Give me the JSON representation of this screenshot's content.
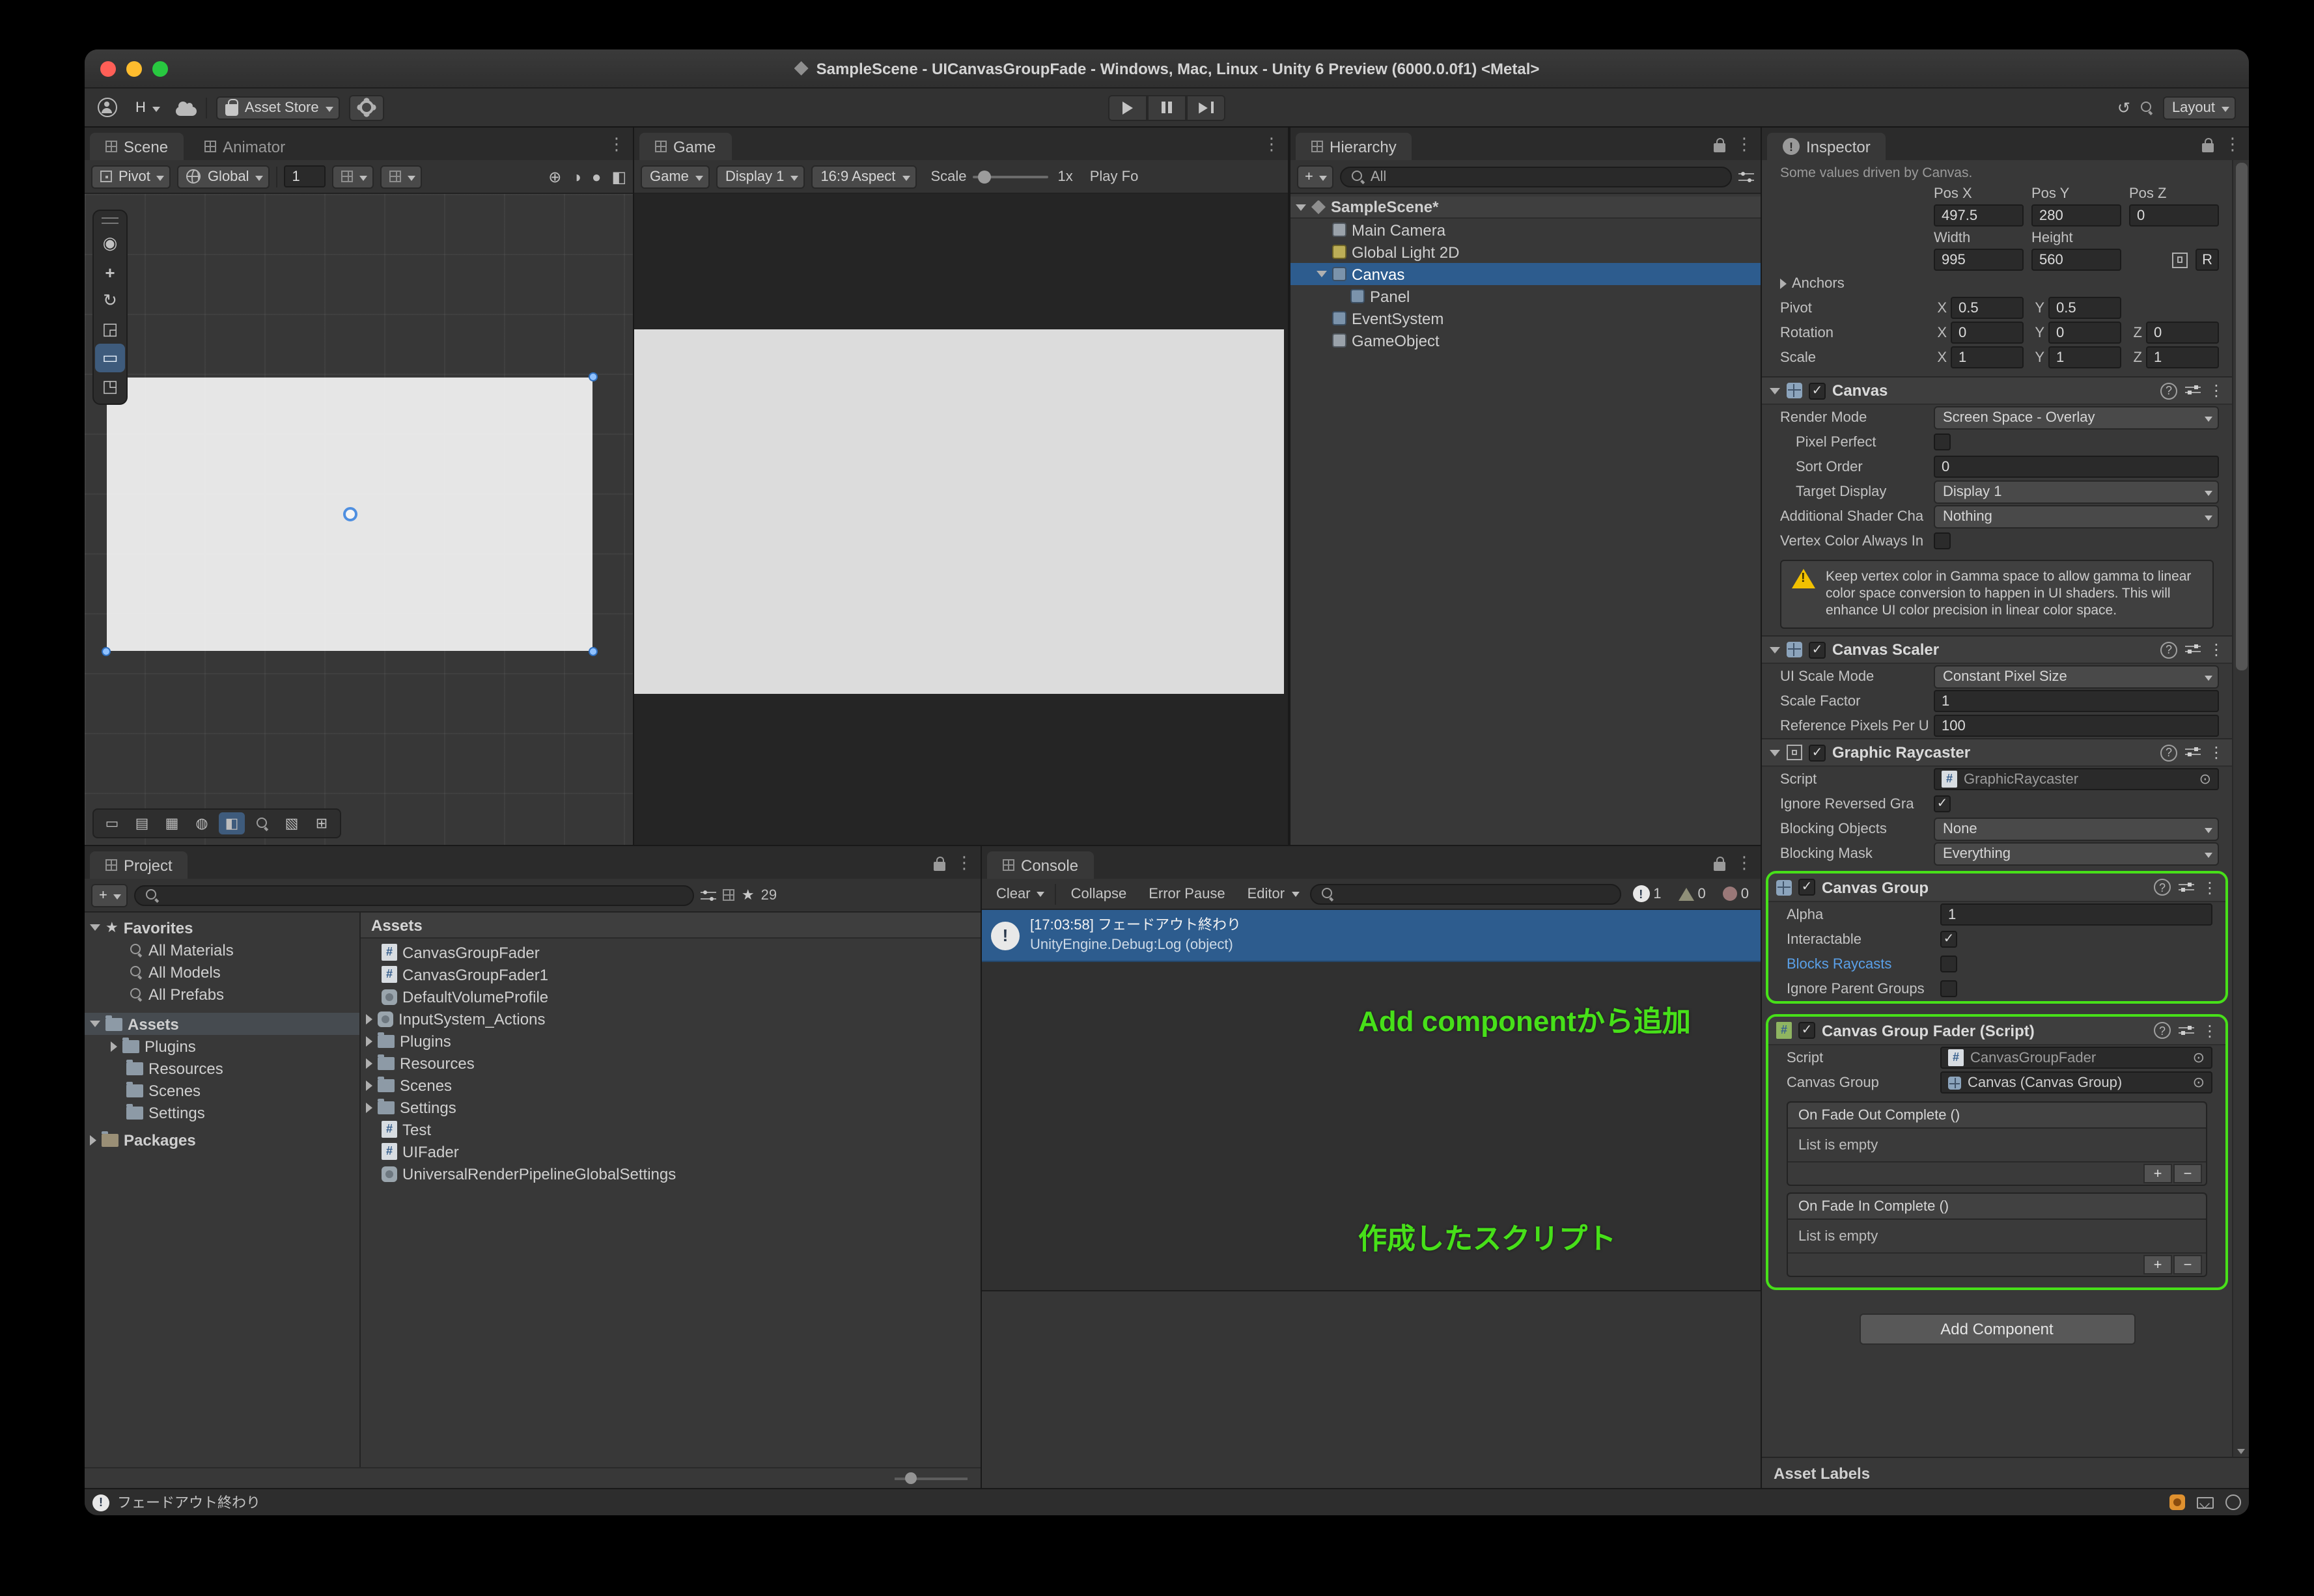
{
  "colors": {
    "accent_green": "#47e019",
    "selection_blue": "#2d5c8e",
    "link_blue": "#5aa0e8",
    "warning_yellow": "#f2c100"
  },
  "titlebar": {
    "title": "SampleScene - UICanvasGroupFade - Windows, Mac, Linux - Unity 6 Preview (6000.0.0f1) <Metal>"
  },
  "toolbar": {
    "account_label": "H",
    "asset_store_label": "Asset Store",
    "layout_label": "Layout"
  },
  "icons": {
    "check": "✓",
    "menu": "⋮",
    "plus": "+",
    "minus": "−",
    "star": "★",
    "history": "↺",
    "picker": "⊙",
    "help": "?",
    "view_tool": "◉",
    "move_tool": "+",
    "rotate_tool": "↻",
    "scale_tool": "◲",
    "rect_tool": "▭",
    "transform_tool": "◳",
    "scene_cam_1": "⊕",
    "scene_cam_2": "◑",
    "scene_cam_3": "●",
    "scene_cam_4": "◧",
    "scene_bottom": [
      "▭",
      "▤",
      "▦",
      "◍",
      "◧",
      "▧",
      "▣",
      "⊞"
    ]
  },
  "scene": {
    "tab": "Scene",
    "tab_animator": "Animator",
    "pivot": "Pivot",
    "global": "Global",
    "grid_size": "1"
  },
  "game": {
    "tab": "Game",
    "menu": "Game",
    "display": "Display 1",
    "aspect": "16:9 Aspect",
    "scale_label": "Scale",
    "scale_value": "1x",
    "play_focused": "Play Fo"
  },
  "hierarchy": {
    "tab": "Hierarchy",
    "search_value": "All",
    "scene_name": "SampleScene*",
    "items": [
      {
        "label": "Main Camera"
      },
      {
        "label": "Global Light 2D"
      },
      {
        "label": "Canvas"
      },
      {
        "label": "Panel"
      },
      {
        "label": "EventSystem"
      },
      {
        "label": "GameObject"
      }
    ]
  },
  "inspector": {
    "tab": "Inspector",
    "driven_note": "Some values driven by Canvas.",
    "rect": {
      "pos_x_label": "Pos X",
      "pos_x": "497.5",
      "pos_y_label": "Pos Y",
      "pos_y": "280",
      "pos_z_label": "Pos Z",
      "pos_z": "0",
      "width_label": "Width",
      "width": "995",
      "height_label": "Height",
      "height": "560",
      "raw_edit": "R",
      "anchors_label": "Anchors",
      "pivot_label": "Pivot",
      "x": "X",
      "y": "Y",
      "z": "Z",
      "pivot_x": "0.5",
      "pivot_y": "0.5",
      "rotation_label": "Rotation",
      "rot_x": "0",
      "rot_y": "0",
      "rot_z": "0",
      "scale_label": "Scale",
      "scale_x": "1",
      "scale_y": "1",
      "scale_z": "1"
    },
    "canvas": {
      "title": "Canvas",
      "render_mode_label": "Render Mode",
      "render_mode": "Screen Space - Overlay",
      "pixel_perfect_label": "Pixel Perfect",
      "sort_order_label": "Sort Order",
      "sort_order": "0",
      "target_display_label": "Target Display",
      "target_display": "Display 1",
      "additional_shader_label": "Additional Shader Cha",
      "additional_shader": "Nothing",
      "vertex_color_label": "Vertex Color Always In",
      "warning": "Keep vertex color in Gamma space to allow gamma to linear color space conversion to happen in UI shaders. This will enhance UI color precision in linear color space."
    },
    "scaler": {
      "title": "Canvas Scaler",
      "ui_scale_mode_label": "UI Scale Mode",
      "ui_scale_mode": "Constant Pixel Size",
      "scale_factor_label": "Scale Factor",
      "scale_factor": "1",
      "ref_pixels_label": "Reference Pixels Per U",
      "ref_pixels": "100"
    },
    "raycaster": {
      "title": "Graphic Raycaster",
      "script_label": "Script",
      "script_value": "GraphicRaycaster",
      "ignore_reversed_label": "Ignore Reversed Gra",
      "blocking_objects_label": "Blocking Objects",
      "blocking_objects": "None",
      "blocking_mask_label": "Blocking Mask",
      "blocking_mask": "Everything"
    },
    "canvas_group": {
      "title": "Canvas Group",
      "alpha_label": "Alpha",
      "alpha": "1",
      "interactable_label": "Interactable",
      "blocks_raycasts_label": "Blocks Raycasts",
      "ignore_parent_label": "Ignore Parent Groups"
    },
    "fader": {
      "title": "Canvas Group Fader (Script)",
      "script_label": "Script",
      "script_value": "CanvasGroupFader",
      "canvas_group_label": "Canvas Group",
      "canvas_group_value": "Canvas (Canvas Group)",
      "fade_out_label": "On Fade Out Complete ()",
      "fade_in_label": "On Fade In Complete ()",
      "list_empty": "List is empty"
    },
    "add_component": "Add Component",
    "asset_labels": "Asset Labels"
  },
  "project": {
    "tab": "Project",
    "hidden_count": "29",
    "favorites_label": "Favorites",
    "favorites": [
      {
        "label": "All Materials"
      },
      {
        "label": "All Models"
      },
      {
        "label": "All Prefabs"
      }
    ],
    "assets_label": "Assets",
    "folders": [
      {
        "label": "Plugins"
      },
      {
        "label": "Resources"
      },
      {
        "label": "Scenes"
      },
      {
        "label": "Settings"
      }
    ],
    "packages_label": "Packages",
    "pane_header": "Assets",
    "files": [
      {
        "name": "CanvasGroupFader"
      },
      {
        "name": "CanvasGroupFader1"
      },
      {
        "name": "DefaultVolumeProfile"
      },
      {
        "name": "InputSystem_Actions"
      },
      {
        "name": "Plugins"
      },
      {
        "name": "Resources"
      },
      {
        "name": "Scenes"
      },
      {
        "name": "Settings"
      },
      {
        "name": "Test"
      },
      {
        "name": "UIFader"
      },
      {
        "name": "UniversalRenderPipelineGlobalSettings"
      }
    ]
  },
  "console": {
    "tab": "Console",
    "clear": "Clear",
    "collapse": "Collapse",
    "error_pause": "Error Pause",
    "editor": "Editor",
    "info_count": "1",
    "warn_count": "0",
    "error_count": "0",
    "log_line1": "[17:03:58] フェードアウト終わり",
    "log_line2": "UnityEngine.Debug:Log (object)"
  },
  "annotations": {
    "add_component": "Add componentから追加",
    "created_script": "作成したスクリプト"
  },
  "statusbar": {
    "message": "フェードアウト終わり"
  }
}
